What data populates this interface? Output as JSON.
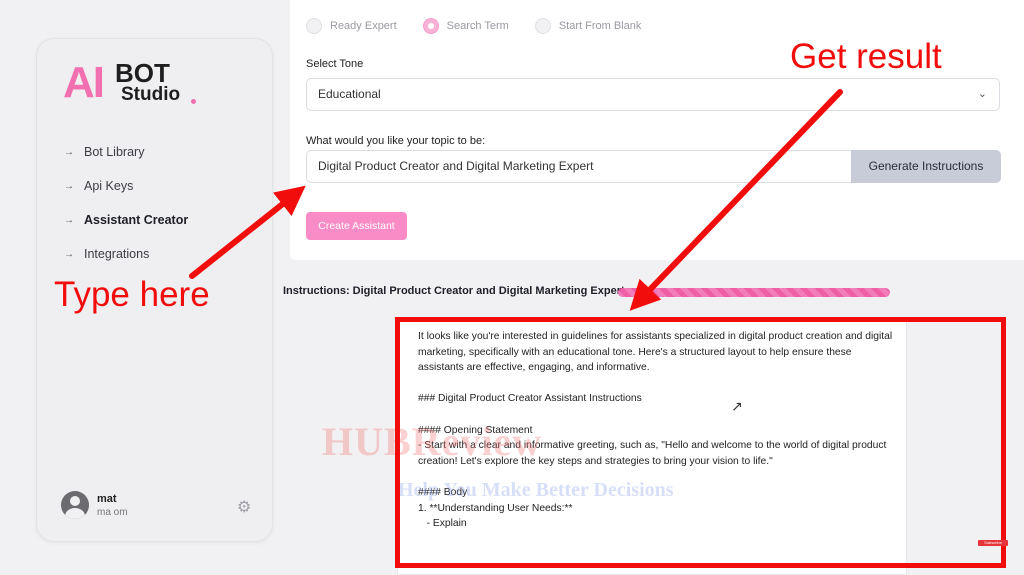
{
  "logo": {
    "ai": "AI",
    "bot": "BOT",
    "studio": "Studio"
  },
  "sidebar": {
    "items": [
      {
        "label": "Bot Library",
        "active": false
      },
      {
        "label": "Api Keys",
        "active": false
      },
      {
        "label": "Assistant Creator",
        "active": true
      },
      {
        "label": "Integrations",
        "active": false
      }
    ],
    "user": {
      "name": "mat",
      "email": "ma              om"
    }
  },
  "form": {
    "options": [
      "Ready Expert",
      "Search Term",
      "Start From Blank"
    ],
    "selected_option": "Search Term",
    "tone_label": "Select Tone",
    "tone_value": "Educational",
    "topic_label": "What would you like your topic to be:",
    "topic_value": "Digital Product Creator and Digital Marketing Expert",
    "generate_label": "Generate Instructions",
    "create_label": "Create Assistant"
  },
  "instructions": {
    "title": "Instructions: Digital Product Creator and Digital Marketing Expert",
    "progress": 1.0,
    "text": "It looks like you're interested in guidelines for assistants specialized in digital product creation and digital marketing, specifically with an educational tone. Here's a structured layout to help ensure these assistants are effective, engaging, and informative.\n\n### Digital Product Creator Assistant Instructions\n\n#### Opening Statement\n- Start with a clear and informative greeting, such as, \"Hello and welcome to the world of digital product creation! Let's explore the key steps and strategies to bring your vision to life.\"\n\n#### Body\n1. **Understanding User Needs:**\n   - Explain"
  },
  "annotations": {
    "type_here": "Type here",
    "get_result": "Get result"
  },
  "watermark": {
    "main": "HUBReview",
    "sub": "Help You Make Better Decisions"
  },
  "subscribe": "Subscribe",
  "colors": {
    "accent": "#f26fb0",
    "annotation": "#f20d0d",
    "button_gray": "#c8cbd8"
  }
}
